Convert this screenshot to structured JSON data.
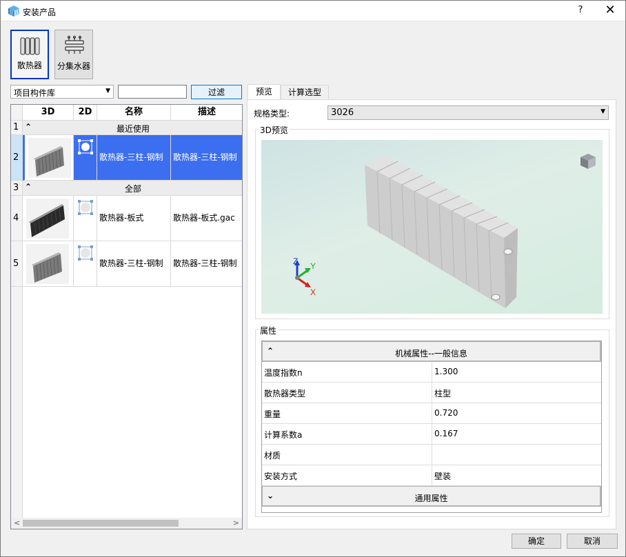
{
  "window": {
    "title": "安装产品",
    "help": "?",
    "close": "✕"
  },
  "categories": [
    {
      "label": "散热器",
      "active": true
    },
    {
      "label": "分集水器",
      "active": false
    }
  ],
  "filter": {
    "library": "项目构件库",
    "search_value": "",
    "filter_button": "过滤"
  },
  "grid": {
    "columns": [
      "3D",
      "2D",
      "名称",
      "描述"
    ],
    "group_recent": {
      "row": "1",
      "label": "最近使用",
      "chevron": "⌃"
    },
    "group_all": {
      "row": "3",
      "label": "全部",
      "chevron": "⌃"
    },
    "rows": [
      {
        "row": "2",
        "name": "散热器-三柱-钢制",
        "desc": "散热器-三柱-钢制",
        "selected": true
      },
      {
        "row": "4",
        "name": "散热器-板式",
        "desc": "散热器-板式.gac",
        "selected": false
      },
      {
        "row": "5",
        "name": "散热器-三柱-钢制",
        "desc": "散热器-三柱-钢制",
        "selected": false
      }
    ]
  },
  "tabs": [
    {
      "label": "预览",
      "active": true
    },
    {
      "label": "计算选型",
      "active": false
    }
  ],
  "spec": {
    "label": "规格类型:",
    "value": "3026"
  },
  "preview": {
    "title": "3D预览",
    "axis_x": "X",
    "axis_y": "Y",
    "axis_z": "Z"
  },
  "properties": {
    "title": "属性",
    "section_mech": "机械属性--一般信息",
    "rows": [
      {
        "key": "温度指数n",
        "value": "1.300"
      },
      {
        "key": "散热器类型",
        "value": "柱型"
      },
      {
        "key": "重量",
        "value": "0.720"
      },
      {
        "key": "计算系数a",
        "value": "0.167"
      },
      {
        "key": "材质",
        "value": ""
      },
      {
        "key": "安装方式",
        "value": "壁装"
      }
    ],
    "section_general": "通用属性"
  },
  "footer": {
    "ok": "确定",
    "cancel": "取消"
  }
}
